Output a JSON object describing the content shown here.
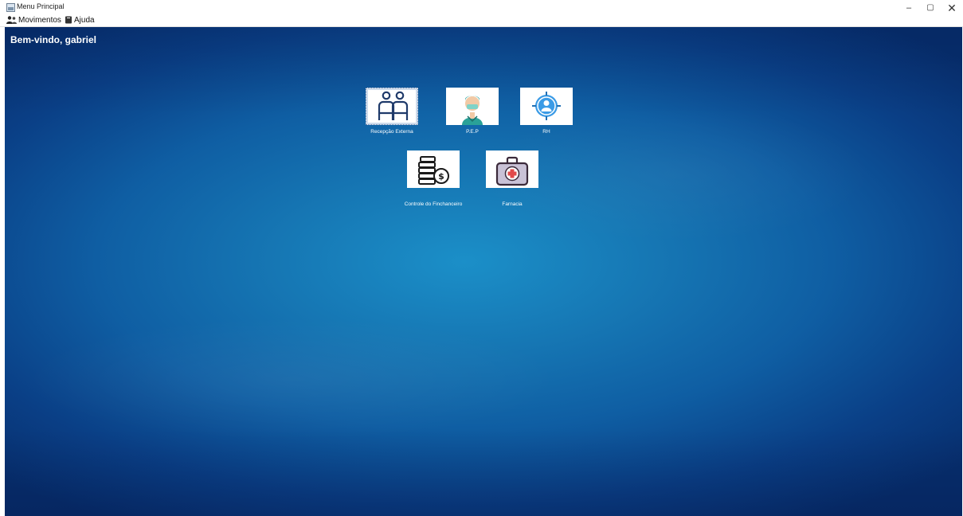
{
  "window": {
    "title": "Menu Principal",
    "controls": {
      "minimize": "–",
      "maximize": "▢",
      "close": "✕"
    }
  },
  "menubar": {
    "items": [
      {
        "label": "Movimentos",
        "icon": "users-icon"
      },
      {
        "label": "Ajuda",
        "icon": "book-icon"
      }
    ]
  },
  "desktop": {
    "welcome": "Bem-vindo, gabriel",
    "background_color": "#1677b4"
  },
  "tiles": [
    {
      "label": "Recepção Externa",
      "icon": "reception-people-icon",
      "selected": true
    },
    {
      "label": "P.E.P",
      "icon": "doctor-icon",
      "selected": false
    },
    {
      "label": "RH",
      "icon": "target-person-icon",
      "selected": false
    },
    {
      "label": "Controle do Finchanceiro",
      "icon": "coins-dollar-icon",
      "selected": false
    },
    {
      "label": "Farnacia",
      "icon": "first-aid-kit-icon",
      "selected": false
    }
  ]
}
